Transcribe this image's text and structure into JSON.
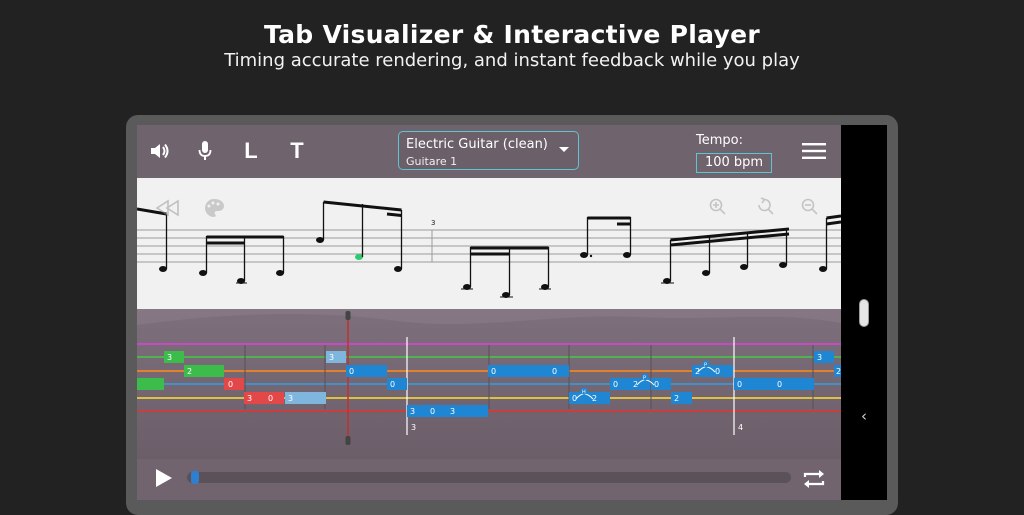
{
  "hero": {
    "title": "Tab Visualizer & Interactive Player",
    "subtitle": "Timing accurate rendering, and instant feedback while you play"
  },
  "toolbar": {
    "volume_icon": "speaker-icon",
    "mic_icon": "microphone-icon",
    "L_label": "L",
    "T_label": "T",
    "instrument": {
      "name": "Electric Guitar (clean)",
      "track": "Guitare 1"
    },
    "tempo": {
      "label": "Tempo:",
      "value": "100 bpm"
    },
    "menu_icon": "hamburger-menu-icon"
  },
  "notation": {
    "measure_numbers": [
      "3"
    ],
    "icons": [
      "rewind-icon",
      "palette-icon",
      "zoom-in-icon",
      "zoom-reset-icon",
      "zoom-out-icon"
    ]
  },
  "tab": {
    "string_colors": [
      "#e040e0",
      "#44cc44",
      "#ff8c1a",
      "#2f9ee8",
      "#ffe033",
      "#e83030"
    ],
    "measure_numbers": [
      "3",
      "4"
    ],
    "notes": [
      {
        "s": 1,
        "label": "3",
        "color": "#3cbc4a"
      },
      {
        "s": 2,
        "label": "2",
        "color": "#3cbc4a"
      },
      {
        "s": 3,
        "label": "",
        "color": "#3cbc4a"
      },
      {
        "s": 3,
        "label": "0",
        "color": "#e34848"
      },
      {
        "s": 4,
        "label": "3",
        "color": "#e34848"
      },
      {
        "s": 4,
        "label": "0",
        "color": "#e34848"
      },
      {
        "s": 4,
        "label": "3",
        "color": "#7fb6dd"
      },
      {
        "s": 1,
        "label": "3",
        "color": "#7fb6dd"
      },
      {
        "s": 2,
        "label": "0",
        "color": "#1f86d3"
      },
      {
        "s": 3,
        "label": "0",
        "color": "#1f86d3"
      },
      {
        "s": 5,
        "label": "3",
        "color": "#1f86d3"
      },
      {
        "s": 5,
        "label": "0",
        "color": "#1f86d3"
      },
      {
        "s": 5,
        "label": "3",
        "color": "#1f86d3"
      },
      {
        "s": 2,
        "label": "0",
        "color": "#1f86d3"
      },
      {
        "s": 2,
        "label": "0",
        "color": "#1f86d3"
      },
      {
        "s": 4,
        "label": "0",
        "color": "#1f86d3"
      },
      {
        "s": 4,
        "label": "2",
        "color": "#1f86d3"
      },
      {
        "s": 3,
        "label": "0",
        "color": "#1f86d3"
      },
      {
        "s": 3,
        "label": "2",
        "color": "#1f86d3"
      },
      {
        "s": 3,
        "label": "0",
        "color": "#1f86d3"
      },
      {
        "s": 4,
        "label": "2",
        "color": "#1f86d3"
      },
      {
        "s": 2,
        "label": "2",
        "color": "#1f86d3"
      },
      {
        "s": 2,
        "label": "0",
        "color": "#1f86d3"
      },
      {
        "s": 3,
        "label": "0",
        "color": "#1f86d3"
      },
      {
        "s": 3,
        "label": "0",
        "color": "#1f86d3"
      },
      {
        "s": 1,
        "label": "3",
        "color": "#1f86d3"
      },
      {
        "s": 2,
        "label": "2",
        "color": "#1f86d3"
      }
    ],
    "technique_labels": [
      "H",
      "P",
      "P"
    ]
  },
  "player": {
    "play_icon": "play-icon",
    "loop_icon": "repeat-icon",
    "progress": 0.003
  },
  "system": {
    "back_icon": "back-chevron-icon",
    "back_glyph": "‹"
  }
}
